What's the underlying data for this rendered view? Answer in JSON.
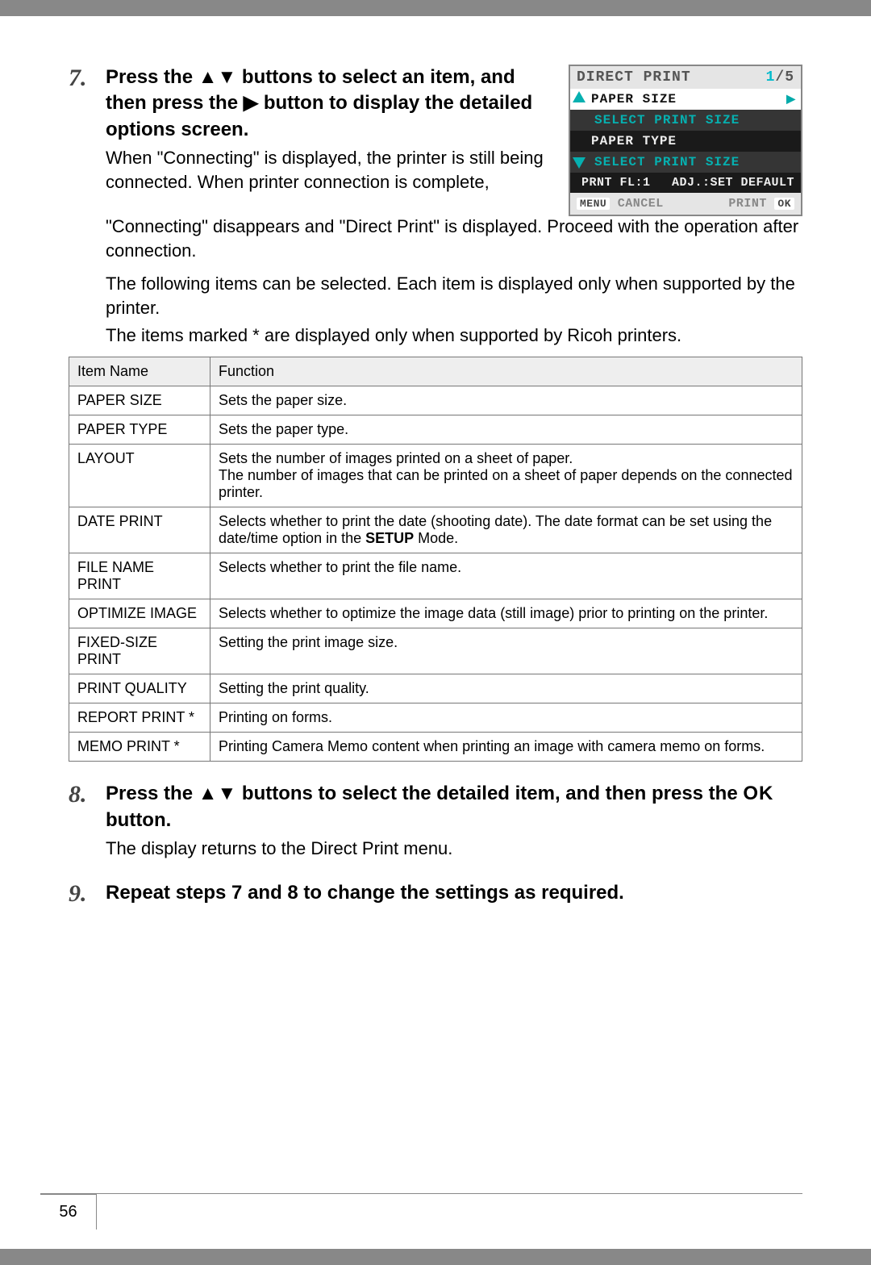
{
  "step7": {
    "num": "7.",
    "title_parts": [
      "Press the ",
      "▲▼",
      " buttons to select an item, and then press the ",
      "▶",
      " button to display the detailed options screen."
    ],
    "body": "When \"Connecting\" is displayed, the printer is still being connected. When printer connection is complete, \"Connecting\" disappears and \"Direct Print\" is displayed. Proceed with the operation after connection.",
    "note1": "The following items can be selected. Each item is displayed only when supported by the printer.",
    "note2": "The items marked * are displayed only when supported by Ricoh printers."
  },
  "lcd": {
    "title": "DIRECT PRINT",
    "page": "1/5",
    "row1": "PAPER SIZE",
    "row1sub": "SELECT PRINT SIZE",
    "row2": "PAPER TYPE",
    "row2sub": "SELECT PRINT SIZE",
    "foot_left": "PRNT FL:1",
    "foot_right": "ADJ.:SET DEFAULT",
    "menu": "MENU",
    "cancel": "CANCEL",
    "print": "PRINT",
    "ok": "OK"
  },
  "table": {
    "head_item": "Item Name",
    "head_func": "Function",
    "rows": [
      {
        "name": "PAPER SIZE",
        "func": "Sets the paper size."
      },
      {
        "name": "PAPER TYPE",
        "func": "Sets the paper type."
      },
      {
        "name": "LAYOUT",
        "func": "Sets the number of images printed on a sheet of paper.\nThe number of images that can be printed on a sheet of paper depends on the connected printer."
      },
      {
        "name": "DATE PRINT",
        "func_pre": "Selects whether to print the date (shooting date). The date format can be set using the date/time option in the ",
        "func_bold": "SETUP",
        "func_post": " Mode."
      },
      {
        "name": "FILE NAME PRINT",
        "func": "Selects whether to print the file name."
      },
      {
        "name": "OPTIMIZE IMAGE",
        "func": "Selects whether to optimize the image data (still image) prior to printing on the printer."
      },
      {
        "name": "FIXED-SIZE PRINT",
        "func": "Setting the print image size."
      },
      {
        "name": "PRINT QUALITY",
        "func": "Setting the print quality."
      },
      {
        "name": "REPORT PRINT *",
        "func": "Printing on forms."
      },
      {
        "name": "MEMO PRINT *",
        "func": "Printing Camera Memo content when printing an image with camera memo on forms."
      }
    ]
  },
  "step8": {
    "num": "8.",
    "title_parts": [
      "Press the ",
      "▲▼",
      " buttons to select the detailed item, and then press the ",
      "OK",
      " button."
    ],
    "body": "The display returns to the Direct Print menu."
  },
  "step9": {
    "num": "9.",
    "title": "Repeat steps 7 and 8 to change the settings as required."
  },
  "pagenum": "56"
}
